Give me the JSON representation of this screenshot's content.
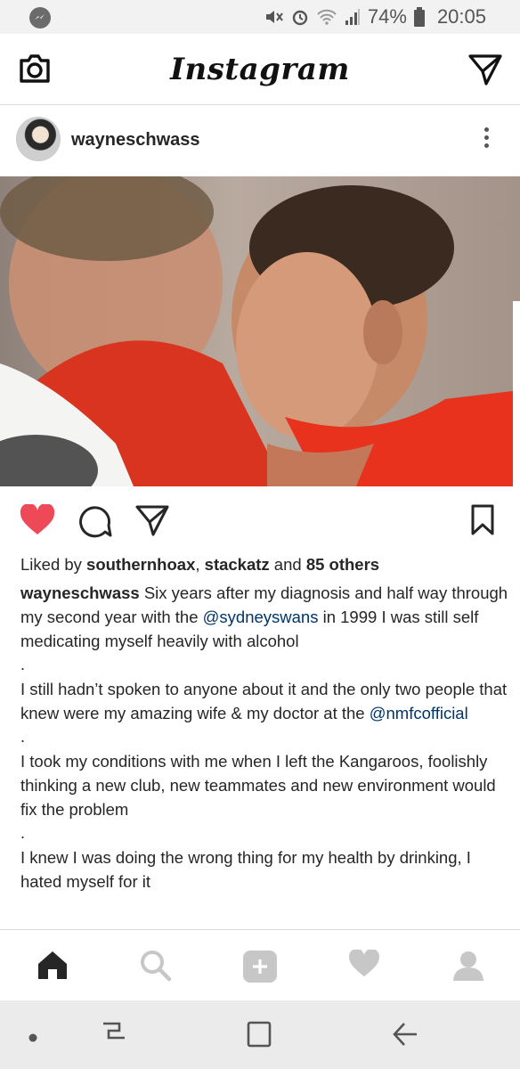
{
  "status_bar": {
    "battery_percent": "74%",
    "time": "20:05",
    "icons": [
      "messenger-icon",
      "mute-icon",
      "alarm-icon",
      "wifi-icon",
      "signal-icon",
      "battery-icon"
    ]
  },
  "app_bar": {
    "title": "Instagram",
    "left_icon": "camera-icon",
    "right_icon": "direct-message-icon"
  },
  "post": {
    "username": "wayneschwass",
    "liked_by": {
      "prefix": "Liked by ",
      "user1": "southernhoax",
      "separator": ", ",
      "user2": "stackatz",
      "and": " and ",
      "others": "85 others"
    },
    "caption": {
      "author": "wayneschwass",
      "p1_a": " Six years after my diagnosis and half way through my second year with the ",
      "p1_mention": "@sydneyswans",
      "p1_b": " in 1999 I was still self medicating myself heavily with alcohol",
      "p2_a": "I still hadn’t spoken to anyone about it and the only two people that knew were my amazing wife & my doctor at the ",
      "p2_mention": "@nmfcofficial",
      "p3": "I took my conditions with me when I left the Kangaroos, foolishly thinking a new club, new teammates and new environment would fix the problem",
      "p4": "I knew I was doing the wrong thing for my health by drinking, I hated myself for it",
      "separator": "."
    }
  },
  "colors": {
    "like_red": "#ed4956",
    "mention_blue": "#003569",
    "jersey_red": "#e8321e"
  },
  "tab_bar": [
    "home-icon",
    "search-icon",
    "add-icon",
    "activity-heart-icon",
    "profile-icon"
  ],
  "nav_bar": [
    "recent-apps-icon",
    "home-button-icon",
    "overview-icon",
    "back-icon"
  ]
}
